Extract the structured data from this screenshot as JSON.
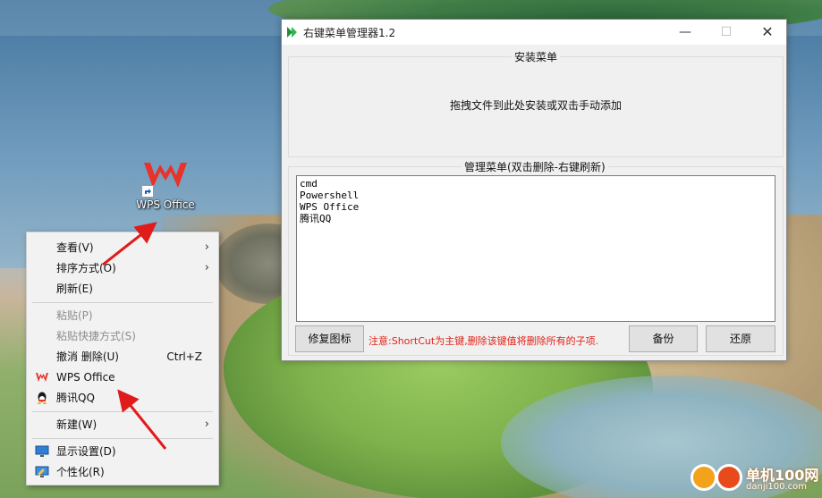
{
  "desktop": {
    "icon_label": "WPS Office"
  },
  "context_menu": {
    "items": [
      {
        "label": "查看(V)",
        "submenu": true
      },
      {
        "label": "排序方式(O)",
        "submenu": true
      },
      {
        "label": "刷新(E)"
      },
      {
        "label": "粘贴(P)",
        "disabled": true
      },
      {
        "label": "粘贴快捷方式(S)",
        "disabled": true
      },
      {
        "label": "撤消 删除(U)",
        "shortcut": "Ctrl+Z"
      },
      {
        "label": "WPS Office",
        "icon": "wps-icon"
      },
      {
        "label": "腾讯QQ",
        "icon": "qq-icon"
      },
      {
        "label": "新建(W)",
        "submenu": true
      },
      {
        "label": "显示设置(D)",
        "icon": "display-icon"
      },
      {
        "label": "个性化(R)",
        "icon": "personalize-icon"
      }
    ]
  },
  "window": {
    "title": "右键菜单管理器1.2",
    "install_group": {
      "title": "安装菜单",
      "hint": "拖拽文件到此处安装或双击手动添加"
    },
    "manage_group": {
      "title": "管理菜单(双击删除-右键刷新)",
      "entries": [
        "cmd",
        "Powershell",
        "WPS Office",
        "腾讯QQ"
      ]
    },
    "buttons": {
      "fix_icon": "修复图标",
      "backup": "备份",
      "restore": "还原"
    },
    "notice": "注意:ShortCut为主键,删除该键值将删除所有的子项."
  },
  "watermark": {
    "text": "单机100网",
    "sub": "danji100.com"
  },
  "colors": {
    "notice_red": "#e0241a",
    "wps_red": "#e8322a",
    "arrow_red": "#e01b1b"
  }
}
